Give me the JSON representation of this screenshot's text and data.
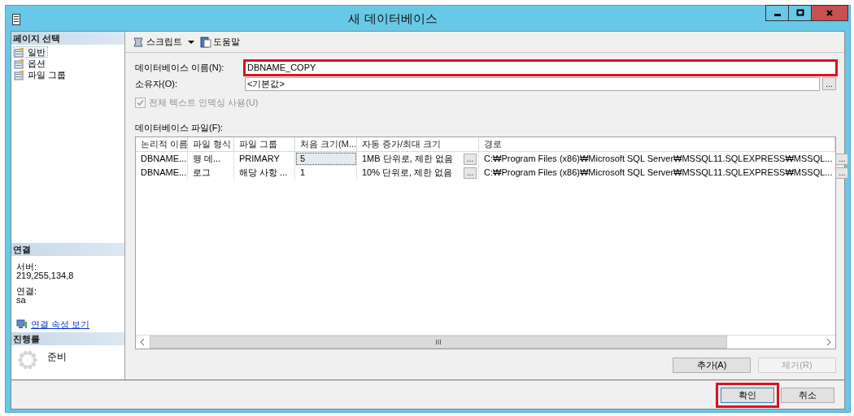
{
  "window": {
    "title": "새 데이터베이스"
  },
  "sidebar": {
    "header": "페이지 선택",
    "items": [
      {
        "label": "일반",
        "selected": true
      },
      {
        "label": "옵션",
        "selected": false
      },
      {
        "label": "파일 그룹",
        "selected": false
      }
    ]
  },
  "connection": {
    "header": "연결",
    "entries": [
      {
        "label": "서버:",
        "value": "219,255,134,8"
      },
      {
        "label": "연결:",
        "value": "sa"
      }
    ],
    "link": "연결 속성 보기"
  },
  "progress": {
    "header": "진행률",
    "status": "준비"
  },
  "toolbar": {
    "items": [
      {
        "label": "스크립트",
        "kind": "script"
      },
      {
        "label": "도움말",
        "kind": "help"
      }
    ]
  },
  "fields": [
    {
      "label": "데이터베이스 이름(N):",
      "value": "DBNAME_COPY",
      "highlighted": true
    },
    {
      "label": "소유자(O):",
      "value": "<기본값>",
      "highlighted": false,
      "browse_button": "..."
    }
  ],
  "fulltext_checkbox": {
    "label": "전체 텍스트 인덱싱 사용(U)",
    "checked": true,
    "disabled": true
  },
  "files": {
    "label": "데이터베이스 파일(F):",
    "columns": [
      "논리적 이름",
      "파일 형식",
      "파일 그룹",
      "처음 크기(M...",
      "자동 증가/최대 크기",
      "경로"
    ],
    "rows": [
      {
        "cells": [
          {
            "text": "DBNAME...",
            "selected": false
          },
          {
            "text": "행 데...",
            "selected": false
          },
          {
            "text": "PRIMARY",
            "selected": false
          },
          {
            "text": "5",
            "selected": true
          },
          {
            "text": "1MB 단위로, 제한 없음",
            "selected": false,
            "button": "..."
          },
          {
            "text": "C:₩Program Files (x86)₩Microsoft SQL Server₩MSSQL11.SQLEXPRESS₩MSSQL...",
            "selected": false,
            "button": "..."
          }
        ]
      },
      {
        "cells": [
          {
            "text": "DBNAME...",
            "selected": false
          },
          {
            "text": "로그",
            "selected": false
          },
          {
            "text": "해당 사항 ...",
            "selected": false
          },
          {
            "text": "1",
            "selected": false
          },
          {
            "text": "10% 단위로, 제한 없음",
            "selected": false,
            "button": "..."
          },
          {
            "text": "C:₩Program Files (x86)₩Microsoft SQL Server₩MSSQL11.SQLEXPRESS₩MSSQL...",
            "selected": false,
            "button": "..."
          }
        ]
      }
    ],
    "scroll_grip": "III"
  },
  "file_buttons": [
    {
      "label": "추가(A)",
      "disabled": false
    },
    {
      "label": "제거(R)",
      "disabled": true
    }
  ],
  "dialog_buttons": [
    {
      "label": "확인",
      "highlighted": true
    },
    {
      "label": "취소",
      "highlighted": false
    }
  ]
}
